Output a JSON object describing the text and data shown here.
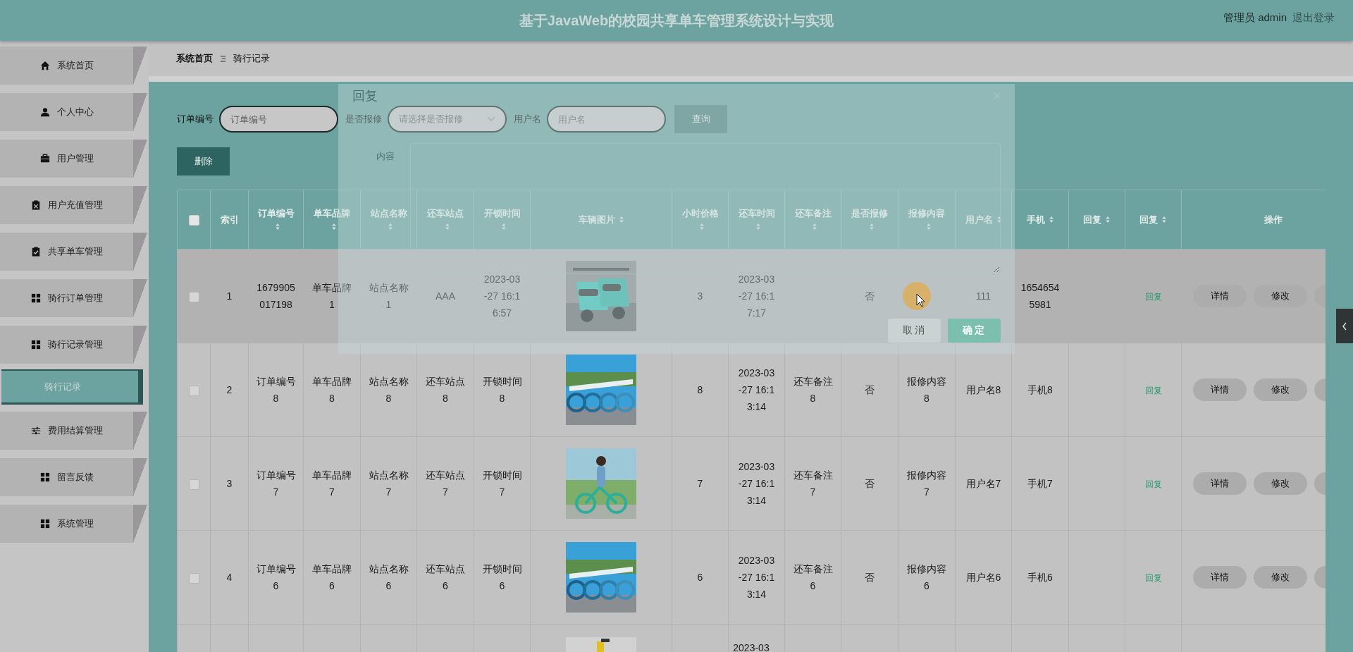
{
  "header": {
    "title": "基于JavaWeb的校园共享单车管理系统设计与实现",
    "user": "管理员 admin",
    "logout": "退出登录"
  },
  "sidebar": {
    "items": [
      {
        "label": "系统首页"
      },
      {
        "label": "个人中心"
      },
      {
        "label": "用户管理"
      },
      {
        "label": "用户充值管理"
      },
      {
        "label": "共享单车管理"
      },
      {
        "label": "骑行订单管理"
      },
      {
        "label": "骑行记录管理",
        "expanded": true,
        "children": [
          {
            "label": "骑行记录",
            "selected": true
          }
        ]
      },
      {
        "label": "费用结算管理"
      },
      {
        "label": "留言反馈"
      },
      {
        "label": "系统管理"
      }
    ]
  },
  "breadcrumb": [
    "系统首页",
    "骑行记录"
  ],
  "search": {
    "fields": [
      {
        "kind": "input",
        "label": "订单编号",
        "placeholder": "订单编号"
      },
      {
        "kind": "select",
        "label": "是否报修",
        "placeholder": "请选择是否报修"
      },
      {
        "kind": "input",
        "label": "用户名",
        "placeholder": "用户名"
      }
    ],
    "button": "查询"
  },
  "delete_button": "删除",
  "table": {
    "columns": [
      {
        "kind": "checkbox",
        "checked": false
      },
      {
        "kind": "text",
        "label": "索引",
        "sortable": false
      },
      {
        "kind": "text",
        "label": "订单编号",
        "sortable": true
      },
      {
        "kind": "text",
        "label": "单车品牌",
        "sortable": true
      },
      {
        "kind": "text",
        "label": "站点名称",
        "sortable": true
      },
      {
        "kind": "text",
        "label": "还车站点",
        "sortable": true
      },
      {
        "kind": "text",
        "label": "开锁时间",
        "sortable": true
      },
      {
        "label": "车辆图片",
        "sortable": true
      },
      {
        "kind": "text",
        "label": "小时价格",
        "sortable": true
      },
      {
        "kind": "text",
        "label": "还车时间",
        "sortable": true
      },
      {
        "kind": "text",
        "label": "还车备注",
        "sortable": true
      },
      {
        "kind": "text",
        "label": "是否报修",
        "sortable": true
      },
      {
        "kind": "text",
        "label": "报修内容",
        "sortable": true
      },
      {
        "kind": "text",
        "label": "用户名",
        "sortable": true
      },
      {
        "kind": "text",
        "label": "手机",
        "sortable": true
      },
      {
        "kind": "text",
        "label": "回复",
        "sortable": true
      },
      {
        "kind": "link",
        "label": "回复",
        "sortable": true
      },
      {
        "kind": "actions",
        "label": "操作",
        "sortable": false
      }
    ],
    "rows": [
      {
        "kind": "full",
        "hovered": true,
        "cells": [
          {
            "kind": "checkbox",
            "checked": false
          },
          "1",
          "1679905017198",
          "单车品牌1",
          "站点名称1",
          "AAA",
          "2023-03-27 16:16:57",
          {
            "kind": "picture"
          },
          "3",
          "2023-03-27 16:17:17",
          "",
          "否",
          "",
          "111",
          "16546545981",
          "",
          "回复",
          [
            "详情",
            "修改"
          ]
        ]
      },
      {
        "kind": "full",
        "hovered": false,
        "cells": [
          {
            "kind": "checkbox",
            "checked": false
          },
          "2",
          "订单编号8",
          "单车品牌8",
          "站点名称8",
          "还车站点8",
          "开锁时间8",
          {
            "kind": "picture"
          },
          "8",
          "2023-03-27 16:13:14",
          "还车备注8",
          "否",
          "报修内容8",
          "用户名8",
          "手机8",
          "",
          "回复",
          [
            "详情",
            "修改"
          ]
        ]
      },
      {
        "kind": "full",
        "hovered": false,
        "cells": [
          {
            "kind": "checkbox",
            "checked": false
          },
          "3",
          "订单编号7",
          "单车品牌7",
          "站点名称7",
          "还车站点7",
          "开锁时间7",
          {
            "kind": "picture"
          },
          "7",
          "2023-03-27 16:13:14",
          "还车备注7",
          "否",
          "报修内容7",
          "用户名7",
          "手机7",
          "",
          "回复",
          [
            "详情",
            "修改"
          ]
        ]
      },
      {
        "kind": "full",
        "hovered": false,
        "cells": [
          {
            "kind": "checkbox",
            "checked": false
          },
          "4",
          "订单编号6",
          "单车品牌6",
          "站点名称6",
          "还车站点6",
          "开锁时间6",
          {
            "kind": "picture"
          },
          "6",
          "2023-03-27 16:13:14",
          "还车备注6",
          "否",
          "报修内容6",
          "用户名6",
          "手机6",
          "",
          "回复",
          [
            "详情",
            "修改"
          ]
        ]
      },
      {
        "kind": "partial",
        "hovered": false,
        "cells": [
          "",
          "",
          "",
          "",
          "",
          "",
          "",
          {
            "kind": "picture"
          },
          "",
          "2023-03",
          "",
          "",
          "",
          "",
          "",
          "",
          "",
          []
        ]
      }
    ]
  },
  "dialog": {
    "title": "回复",
    "content_label": "内容",
    "buttons": [
      {
        "kind": "cancel",
        "label": "取消"
      },
      {
        "kind": "primary",
        "label": "确定"
      }
    ]
  }
}
